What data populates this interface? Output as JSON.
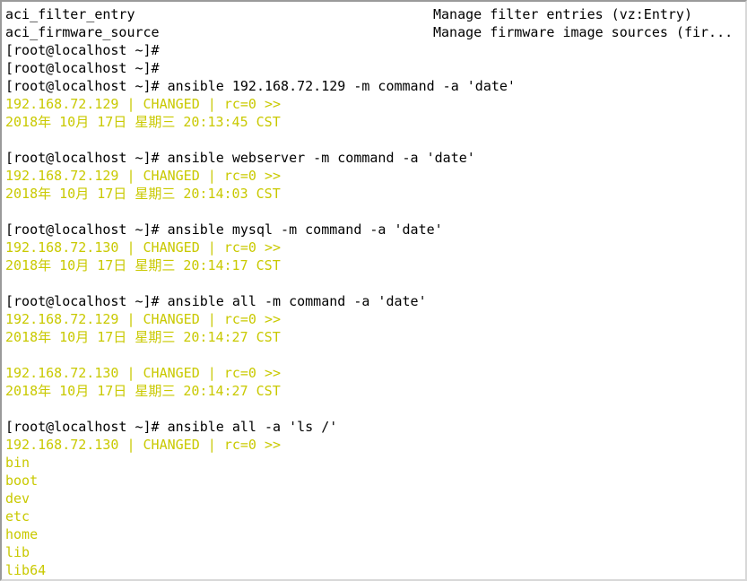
{
  "terminal": {
    "title": "root@localhost:~",
    "colors": {
      "background": "#ffffff",
      "foreground": "#000000",
      "output_yellow": "#c9c900",
      "border_dark": "#9a9a9a",
      "border_light": "#d8d8d8"
    },
    "prompt": "[root@localhost ~]#",
    "module_list_header": {
      "rows": [
        {
          "name": "aci_filter_entry",
          "description": "Manage filter entries (vz:Entry)"
        },
        {
          "name": "aci_firmware_source",
          "description": "Manage firmware image sources (fir..."
        }
      ]
    },
    "lines": [
      {
        "id": "l1",
        "type": "module-row",
        "name": "aci_filter_entry",
        "description": "Manage filter entries (vz:Entry)"
      },
      {
        "id": "l2",
        "type": "module-row",
        "name": "aci_firmware_source",
        "description": "Manage firmware image sources (fir..."
      },
      {
        "id": "l3",
        "type": "prompt",
        "color": "default",
        "text": "[root@localhost ~]#"
      },
      {
        "id": "l4",
        "type": "prompt",
        "color": "default",
        "text": "[root@localhost ~]#"
      },
      {
        "id": "l5",
        "type": "command",
        "color": "default",
        "text": "[root@localhost ~]# ansible 192.168.72.129 -m command -a 'date'"
      },
      {
        "id": "l6",
        "type": "output",
        "color": "yellow",
        "text": "192.168.72.129 | CHANGED | rc=0 >>"
      },
      {
        "id": "l7",
        "type": "output",
        "color": "yellow",
        "text": "2018年 10月 17日 星期三 20:13:45 CST"
      },
      {
        "id": "l8",
        "type": "blank",
        "color": "default",
        "text": ""
      },
      {
        "id": "l9",
        "type": "command",
        "color": "default",
        "text": "[root@localhost ~]# ansible webserver -m command -a 'date'"
      },
      {
        "id": "l10",
        "type": "output",
        "color": "yellow",
        "text": "192.168.72.129 | CHANGED | rc=0 >>"
      },
      {
        "id": "l11",
        "type": "output",
        "color": "yellow",
        "text": "2018年 10月 17日 星期三 20:14:03 CST"
      },
      {
        "id": "l12",
        "type": "blank",
        "color": "default",
        "text": ""
      },
      {
        "id": "l13",
        "type": "command",
        "color": "default",
        "text": "[root@localhost ~]# ansible mysql -m command -a 'date'"
      },
      {
        "id": "l14",
        "type": "output",
        "color": "yellow",
        "text": "192.168.72.130 | CHANGED | rc=0 >>"
      },
      {
        "id": "l15",
        "type": "output",
        "color": "yellow",
        "text": "2018年 10月 17日 星期三 20:14:17 CST"
      },
      {
        "id": "l16",
        "type": "blank",
        "color": "default",
        "text": ""
      },
      {
        "id": "l17",
        "type": "command",
        "color": "default",
        "text": "[root@localhost ~]# ansible all -m command -a 'date'"
      },
      {
        "id": "l18",
        "type": "output",
        "color": "yellow",
        "text": "192.168.72.129 | CHANGED | rc=0 >>"
      },
      {
        "id": "l19",
        "type": "output",
        "color": "yellow",
        "text": "2018年 10月 17日 星期三 20:14:27 CST"
      },
      {
        "id": "l20",
        "type": "blank",
        "color": "default",
        "text": ""
      },
      {
        "id": "l21",
        "type": "output",
        "color": "yellow",
        "text": "192.168.72.130 | CHANGED | rc=0 >>"
      },
      {
        "id": "l22",
        "type": "output",
        "color": "yellow",
        "text": "2018年 10月 17日 星期三 20:14:27 CST"
      },
      {
        "id": "l23",
        "type": "blank",
        "color": "default",
        "text": ""
      },
      {
        "id": "l24",
        "type": "command",
        "color": "default",
        "text": "[root@localhost ~]# ansible all -a 'ls /'"
      },
      {
        "id": "l25",
        "type": "output",
        "color": "yellow",
        "text": "192.168.72.130 | CHANGED | rc=0 >>"
      },
      {
        "id": "l26",
        "type": "output",
        "color": "yellow",
        "text": "bin"
      },
      {
        "id": "l27",
        "type": "output",
        "color": "yellow",
        "text": "boot"
      },
      {
        "id": "l28",
        "type": "output",
        "color": "yellow",
        "text": "dev"
      },
      {
        "id": "l29",
        "type": "output",
        "color": "yellow",
        "text": "etc"
      },
      {
        "id": "l30",
        "type": "output",
        "color": "yellow",
        "text": "home"
      },
      {
        "id": "l31",
        "type": "output",
        "color": "yellow",
        "text": "lib"
      },
      {
        "id": "l32",
        "type": "output",
        "color": "yellow",
        "text": "lib64"
      }
    ]
  }
}
